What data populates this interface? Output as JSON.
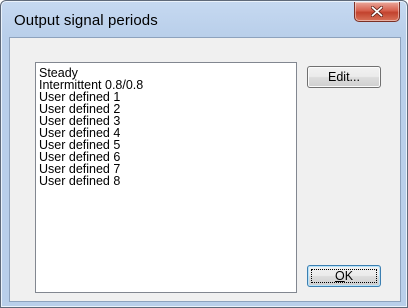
{
  "window": {
    "title": "Output signal periods"
  },
  "list": {
    "items": [
      "Steady",
      "Intermittent 0.8/0.8",
      "User defined 1",
      "User defined 2",
      "User defined 3",
      "User defined 4",
      "User defined 5",
      "User defined 6",
      "User defined 7",
      "User defined 8"
    ]
  },
  "buttons": {
    "edit_label": "Edit...",
    "ok_label_mnemonic": "O",
    "ok_label_rest": "K"
  },
  "icons": {
    "close": "close-icon"
  },
  "colors": {
    "close_button": "#c9463a",
    "titlebar": "#c6d9f1",
    "client_background": "#f0f0f0"
  }
}
